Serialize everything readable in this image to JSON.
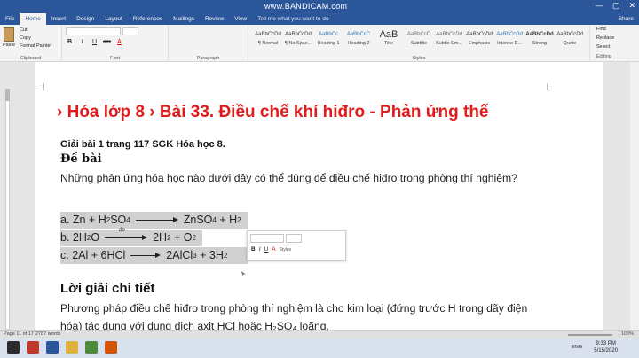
{
  "watermark": "www.BANDICAM.com",
  "window_controls": [
    "—",
    "▢",
    "✕"
  ],
  "tabs": [
    "File",
    "Home",
    "Insert",
    "Design",
    "Layout",
    "References",
    "Mailings",
    "Review",
    "View"
  ],
  "tell_me": "Tell me what you want to do",
  "share": "Share",
  "clipboard": {
    "paste": "Paste",
    "cut": "Cut",
    "copy": "Copy",
    "format_painter": "Format Painter",
    "label": "Clipboard"
  },
  "font_group": {
    "label": "Font",
    "bold": "B",
    "italic": "I",
    "underline": "U",
    "strike": "abc",
    "color_a": "A"
  },
  "paragraph_label": "Paragraph",
  "styles_label": "Styles",
  "styles": [
    {
      "sample": "AaBbCcDd",
      "name": "¶ Normal"
    },
    {
      "sample": "AaBbCcDd",
      "name": "¶ No Spac..."
    },
    {
      "sample": "AaBbCc",
      "name": "Heading 1"
    },
    {
      "sample": "AaBbCcC",
      "name": "Heading 2"
    },
    {
      "sample": "AaB",
      "name": "Title"
    },
    {
      "sample": "AaBbCcD",
      "name": "Subtitle"
    },
    {
      "sample": "AaBbCcDd",
      "name": "Subtle Em..."
    },
    {
      "sample": "AaBbCcDd",
      "name": "Emphasis"
    },
    {
      "sample": "AaBbCcDd",
      "name": "Intense E..."
    },
    {
      "sample": "AaBbCcDd",
      "name": "Strong"
    },
    {
      "sample": "AaBbCcDd",
      "name": "Quote"
    }
  ],
  "editing": {
    "find": "Find",
    "replace": "Replace",
    "select": "Select",
    "label": "Editing"
  },
  "doc": {
    "title": "› Hóa lớp 8 › Bài 33. Điều chế khí hiđro - Phản ứng thế",
    "sub1": "Giải bài 1 trang 117 SGK Hóa học 8.",
    "de_bai": "Đề bài",
    "question": "Những phản ứng hóa học nào dưới đây có thể dùng để điều chế hiđro trong phòng thí nghiệm?",
    "eq_a_left": "a. Zn + H",
    "eq_a_s1": "2",
    "eq_a_m1": "SO",
    "eq_a_s2": "4",
    "eq_a_right": "ZnSO",
    "eq_a_s3": "4",
    "eq_a_end": " + H",
    "eq_a_s4": "2",
    "eq_b_left": "b. 2H",
    "eq_b_s1": "2",
    "eq_b_o": "O",
    "eq_b_cond": "đp",
    "eq_b_right": "2H",
    "eq_b_s2": "2",
    "eq_b_end": " + O",
    "eq_b_s3": "2",
    "eq_c_left": "c. 2Al + 6HCl",
    "eq_c_right": "2AlCl",
    "eq_c_s1": "3",
    "eq_c_end": " + 3H",
    "eq_c_s2": "2",
    "loi_giai": "Lời giải chi tiết",
    "answer": "Phương pháp điều chế hiđro trong phòng thí nghiệm là cho kim loại (đứng trước H trong dãy điện hóa) tác dụng với dung dịch axit HCl hoặc H₂SO₄ loãng."
  },
  "mini_toolbar": {
    "styles": "Styles"
  },
  "status": {
    "page": "Page 11 of 17",
    "words": "2787 words",
    "zoom": "100%"
  },
  "taskbar": {
    "lang": "ENG",
    "time": "9:33 PM",
    "date": "5/15/2020"
  }
}
